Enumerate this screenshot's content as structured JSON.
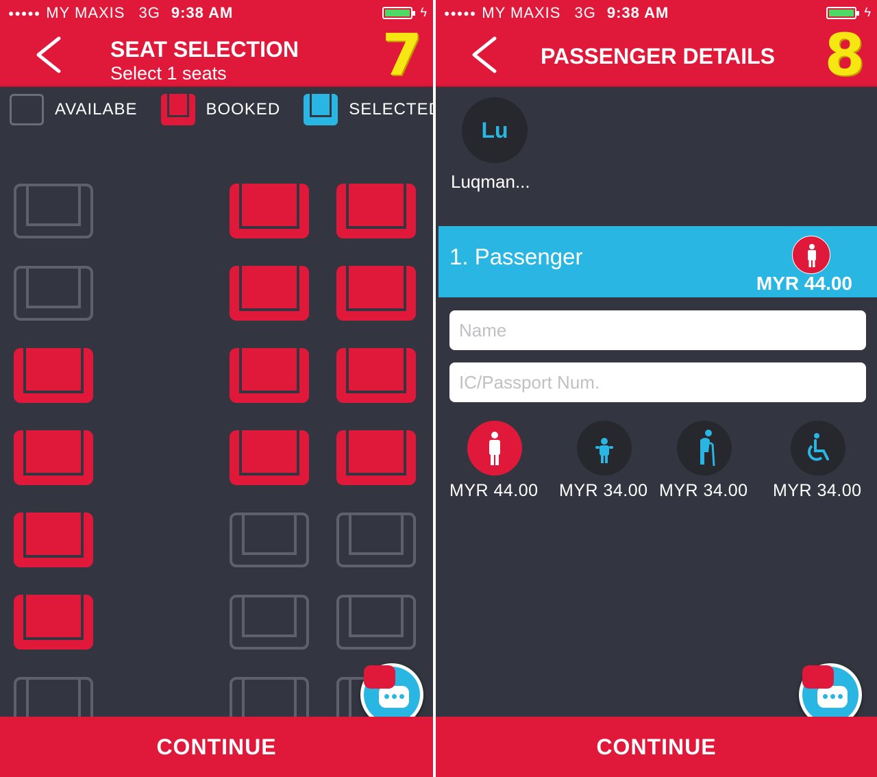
{
  "status_bar": {
    "dots": "●●●●●",
    "carrier": "MY MAXIS",
    "network": "3G",
    "time": "9:38 AM"
  },
  "left_screen": {
    "title": "SEAT SELECTION",
    "subtitle": "Select 1 seats",
    "step": "7",
    "legend": {
      "available": "AVAILABE",
      "booked": "BOOKED",
      "selected": "SELECTED"
    },
    "seat_rows": [
      [
        "available",
        "booked",
        "booked"
      ],
      [
        "available",
        "booked",
        "booked"
      ],
      [
        "booked",
        "booked",
        "booked"
      ],
      [
        "booked",
        "booked",
        "booked"
      ],
      [
        "booked",
        "available",
        "available"
      ],
      [
        "booked",
        "available",
        "available"
      ],
      [
        "available",
        "available",
        "available"
      ]
    ],
    "continue_label": "CONTINUE"
  },
  "right_screen": {
    "title": "PASSENGER DETAILS",
    "step": "8",
    "avatar_initials": "Lu",
    "user_name": "Luqman...",
    "passenger_label": "1. Passenger",
    "passenger_price": "MYR 44.00",
    "name_placeholder": "Name",
    "ic_placeholder": "IC/Passport Num.",
    "passenger_types": [
      {
        "type": "adult",
        "price": "MYR 44.00",
        "selected": true
      },
      {
        "type": "child",
        "price": "MYR 34.00",
        "selected": false
      },
      {
        "type": "senior",
        "price": "MYR 34.00",
        "selected": false
      },
      {
        "type": "disabled",
        "price": "MYR 34.00",
        "selected": false
      }
    ],
    "continue_label": "CONTINUE"
  },
  "colors": {
    "brand_red": "#e0193a",
    "accent_blue": "#29b6e2",
    "background": "#333640",
    "step_yellow": "#f6e713"
  }
}
